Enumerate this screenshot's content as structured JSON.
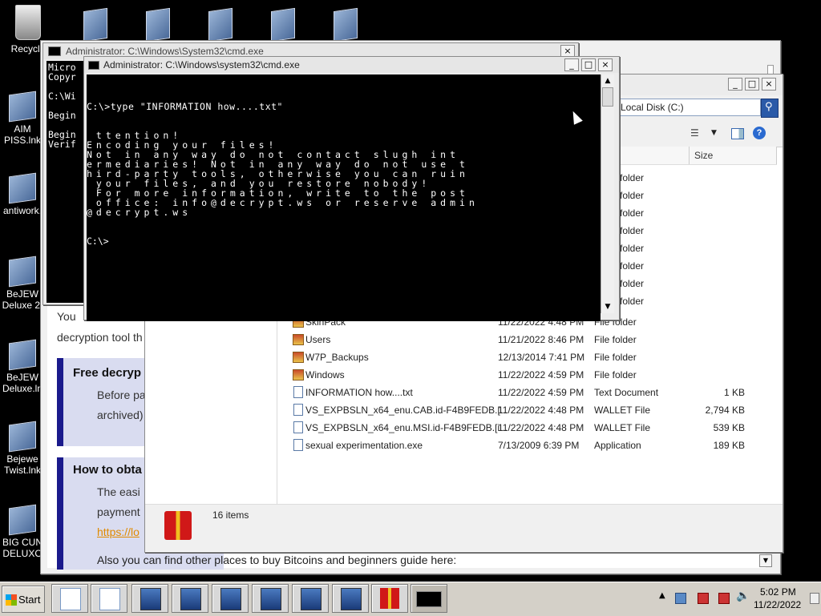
{
  "desktop": {
    "icons": [
      {
        "label": "Recycle"
      },
      {
        "label": "AIM PISS.lnk"
      },
      {
        "label": "antiwork."
      },
      {
        "label": "BeJEW Deluxe 2."
      },
      {
        "label": "BeJEW Deluxe.ln"
      },
      {
        "label": "Bejewe Twist.lnk"
      },
      {
        "label": "BIG CUN DELUXO"
      }
    ]
  },
  "cmd_back": {
    "title": "Administrator: C:\\Windows\\System32\\cmd.exe",
    "lines": [
      "Micro",
      "Copyr",
      "",
      "C:\\Wi",
      "",
      "Begin",
      "",
      "Begin",
      "Verif"
    ]
  },
  "cmd_front": {
    "title": "Administrator: C:\\Windows\\system32\\cmd.exe",
    "command": "C:\\>type \"INFORMATION how....txt\"",
    "output": [
      " ttention!",
      "Encoding your files!",
      "Not in any way do not contact slugh int",
      "ermediaries! Not in any way do not use t",
      "hird-party tools, otherwise you can ruin",
      " your files, and you restore nobody!",
      " For more information, write to the post",
      " office: info@decrypt.ws or reserve admin",
      "@decrypt.ws"
    ],
    "prompt": "C:\\>"
  },
  "browser": {
    "text_you": "You",
    "text_decryption": "decryption tool th",
    "section1_heading": "Free decryp",
    "section1_line1": "Before pa",
    "section1_line2": "archived)",
    "section2_heading": "How to obta",
    "section2_line1": "The easi",
    "section2_line2": "payment",
    "section2_link": "https://lo",
    "bottom_line": "Also you can find other places to buy Bitcoins and beginners guide here:"
  },
  "explorer": {
    "address": "Local Disk (C:)",
    "size_header": "Size",
    "partial_rows": [
      "folder",
      "folder",
      "folder",
      "folder",
      "folder",
      "folder",
      "folder",
      "folder"
    ],
    "rows": [
      {
        "name": "SkinPack",
        "date": "11/22/2022 4:48 PM",
        "type": "File folder",
        "size": "",
        "icon": "folder"
      },
      {
        "name": "Users",
        "date": "11/21/2022 8:46 PM",
        "type": "File folder",
        "size": "",
        "icon": "folder"
      },
      {
        "name": "W7P_Backups",
        "date": "12/13/2014 7:41 PM",
        "type": "File folder",
        "size": "",
        "icon": "folder"
      },
      {
        "name": "Windows",
        "date": "11/22/2022 4:59 PM",
        "type": "File folder",
        "size": "",
        "icon": "folder"
      },
      {
        "name": "INFORMATION how....txt",
        "date": "11/22/2022 4:59 PM",
        "type": "Text Document",
        "size": "1 KB",
        "icon": "file"
      },
      {
        "name": "VS_EXPBSLN_x64_enu.CAB.id-F4B9FEDB.[...",
        "date": "11/22/2022 4:48 PM",
        "type": "WALLET File",
        "size": "2,794 KB",
        "icon": "file"
      },
      {
        "name": "VS_EXPBSLN_x64_enu.MSI.id-F4B9FEDB.[i...",
        "date": "11/22/2022 4:48 PM",
        "type": "WALLET File",
        "size": "539 KB",
        "icon": "file"
      },
      {
        "name": "sexual experimentation.exe",
        "date": "7/13/2009 6:39 PM",
        "type": "Application",
        "size": "189 KB",
        "icon": "exe"
      }
    ],
    "status_count": "16 items"
  },
  "taskbar": {
    "start_label": "Start",
    "time": "5:02 PM",
    "date": "11/22/2022"
  },
  "colors": {
    "accent_blue": "#1a1a8c",
    "link_orange": "#e08a00",
    "section_bg": "#d9dcf0"
  }
}
